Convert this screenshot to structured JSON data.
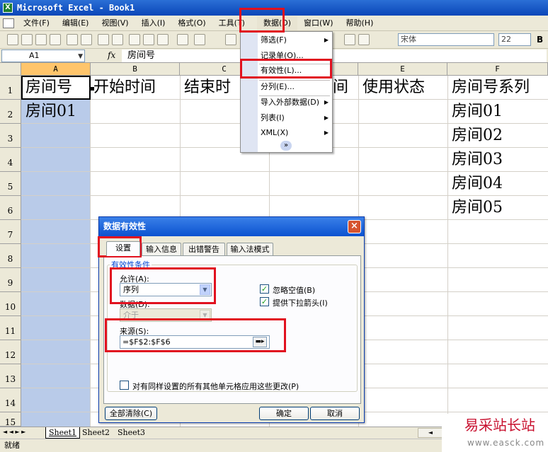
{
  "window": {
    "title": "Microsoft Excel - Book1",
    "app_icon": "excel-icon"
  },
  "menu": {
    "items": [
      "文件(F)",
      "编辑(E)",
      "视图(V)",
      "插入(I)",
      "格式(O)",
      "工具(T)",
      "数据(D)",
      "窗口(W)",
      "帮助(H)"
    ]
  },
  "toolbar": {
    "font_name": "宋体",
    "font_size": "22",
    "bold": "B"
  },
  "formula_bar": {
    "name_box": "A1",
    "fx": "fx",
    "formula": "房间号"
  },
  "grid": {
    "columns": [
      "A",
      "B",
      "C",
      "D",
      "E",
      "F"
    ],
    "rows": [
      "1",
      "2",
      "3",
      "4",
      "5",
      "6",
      "7",
      "8",
      "9",
      "10",
      "11",
      "12",
      "13",
      "14",
      "15"
    ],
    "cells": {
      "A1": "房间号",
      "B1": "开始时间",
      "C1": "结束时",
      "D1": "间",
      "E1": "使用状态",
      "F1": "房间号系列",
      "A2": "房间01",
      "F2": "房间01",
      "F3": "房间02",
      "F4": "房间03",
      "F5": "房间04",
      "F6": "房间05"
    }
  },
  "data_menu": {
    "items": [
      "筛选(F)",
      "记录单(O)...",
      "有效性(L)...",
      "分列(E)...",
      "导入外部数据(D)",
      "列表(I)",
      "XML(X)"
    ],
    "expand": "»"
  },
  "dialog": {
    "title": "数据有效性",
    "close": "×",
    "tabs": [
      "设置",
      "输入信息",
      "出错警告",
      "输入法模式"
    ],
    "group_label": "有效性条件",
    "allow_label": "允许(A):",
    "allow_value": "序列",
    "data_label": "数据(D):",
    "data_value": "介于",
    "ignore_blank": "忽略空值(B)",
    "dropdown_arrow": "提供下拉箭头(I)",
    "source_label": "来源(S):",
    "source_value": "=$F$2:$F$6",
    "apply_all": "对有同样设置的所有其他单元格应用这些更改(P)",
    "clear_all": "全部清除(C)",
    "ok": "确定",
    "cancel": "取消"
  },
  "sheets": {
    "tabs": [
      "Sheet1",
      "Sheet2",
      "Sheet3"
    ],
    "nav": "◄ ◄ ► ►"
  },
  "status": {
    "text": "就绪"
  },
  "watermark": {
    "main": "易采站长站",
    "sub": "www.easck.com"
  },
  "colors": {
    "highlight_red": "#e1111f",
    "selection_blue": "#b9cbe9",
    "title_blue": "#0a46b8"
  }
}
